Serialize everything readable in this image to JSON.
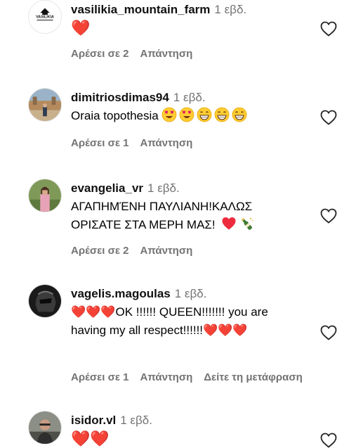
{
  "comments": [
    {
      "username": "vasilikia_mountain_farm",
      "time": "1 εβδ.",
      "text": "❤️",
      "likes_label": "Αρέσει σε 2",
      "reply_label": "Απάντηση",
      "avatar_logo_text": "VASILIKIA"
    },
    {
      "username": "dimitriosdimas94",
      "time": "1 εβδ.",
      "text": "Oraia topothesia",
      "emojis": [
        "heart-eyes",
        "heart-eyes",
        "grin",
        "grin",
        "grin"
      ],
      "likes_label": "Αρέσει σε 1",
      "reply_label": "Απάντηση"
    },
    {
      "username": "evangelia_vr",
      "time": "1 εβδ.",
      "text": "ΑΓΑΠΗΜΈΝΗ ΠΑΥΛΙΑΝΗ!ΚΑΛΩΣ ΟΡΙΣΑΤΕ ΣΤΑ ΜΕΡΗ ΜΑΣ!",
      "emojis": [
        "red-heart",
        "champagne"
      ],
      "likes_label": "Αρέσει σε 2",
      "reply_label": "Απάντηση"
    },
    {
      "username": "vagelis.magoulas",
      "time": "1 εβδ.",
      "text": "❤️❤️❤️ΟΚ !!!!!! QUEEN!!!!!!! you are having my all respect!!!!!!❤️❤️❤️",
      "likes_label": "Αρέσει σε 1",
      "reply_label": "Απάντηση",
      "translate_label": "Δείτε τη μετάφραση"
    },
    {
      "username": "isidor.vl",
      "time": "1 εβδ.",
      "text": "❤️❤️"
    }
  ],
  "colors": {
    "heart": "#ed2c3d",
    "muted": "#737373"
  },
  "icons": {
    "like": "heart-outline-icon"
  }
}
